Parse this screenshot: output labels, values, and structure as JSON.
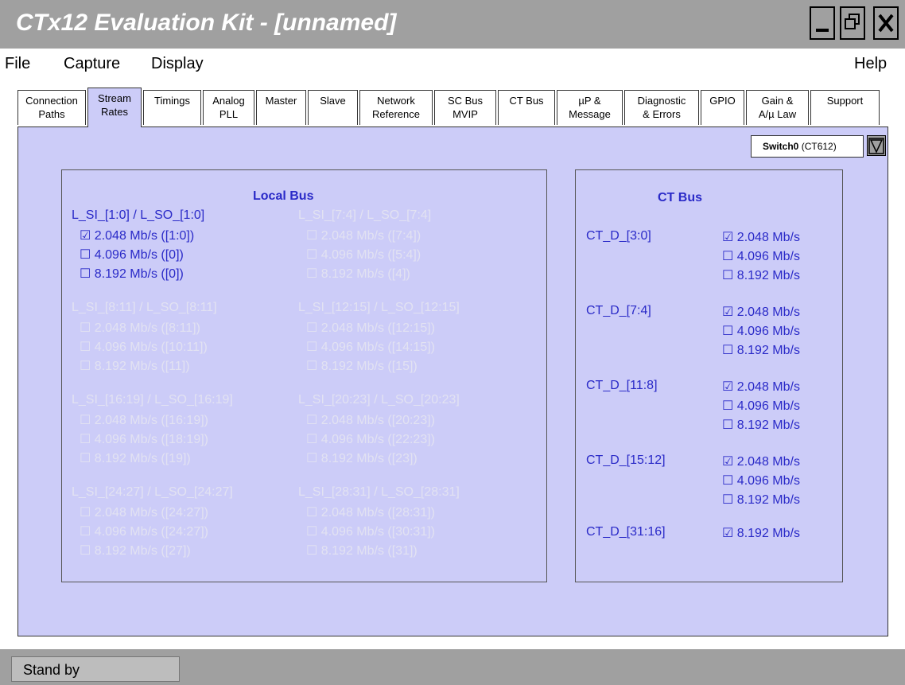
{
  "window": {
    "title": "CTx12 Evaluation Kit - [unnamed]"
  },
  "menu": {
    "file": "File",
    "capture": "Capture",
    "display": "Display",
    "help": "Help"
  },
  "tabs": [
    {
      "id": "connection",
      "line1": "Connection",
      "line2": "Paths"
    },
    {
      "id": "stream",
      "line1": "Stream",
      "line2": "Rates",
      "active": true
    },
    {
      "id": "timings",
      "line1": "Timings",
      "line2": ""
    },
    {
      "id": "analog",
      "line1": "Analog",
      "line2": "PLL"
    },
    {
      "id": "master",
      "line1": "Master",
      "line2": ""
    },
    {
      "id": "slave",
      "line1": "Slave",
      "line2": ""
    },
    {
      "id": "network",
      "line1": "Network",
      "line2": "Reference"
    },
    {
      "id": "scbus",
      "line1": "SC Bus",
      "line2": "MVIP"
    },
    {
      "id": "ctbus",
      "line1": "CT Bus",
      "line2": ""
    },
    {
      "id": "up",
      "line1": "µP &",
      "line2": "Message"
    },
    {
      "id": "diag",
      "line1": "Diagnostic",
      "line2": "& Errors"
    },
    {
      "id": "gpio",
      "line1": "GPIO",
      "line2": ""
    },
    {
      "id": "gain",
      "line1": "Gain &",
      "line2": "A/µ Law"
    },
    {
      "id": "support",
      "line1": "Support",
      "line2": ""
    }
  ],
  "device": {
    "name": "Switch0",
    "model": "(CT612)"
  },
  "local_bus": {
    "title": "Local Bus",
    "groups": [
      {
        "label": "L_SI_[1:0] / L_SO_[1:0]",
        "enabled": true,
        "options": [
          {
            "text": "2.048 Mb/s ([1:0])",
            "checked": true
          },
          {
            "text": "4.096 Mb/s ([0])",
            "checked": false
          },
          {
            "text": "8.192 Mb/s ([0])",
            "checked": false
          }
        ]
      },
      {
        "label": "L_SI_[7:4] / L_SO_[7:4]",
        "enabled": false,
        "options": [
          {
            "text": "2.048 Mb/s ([7:4])",
            "checked": false
          },
          {
            "text": "4.096 Mb/s ([5:4])",
            "checked": false
          },
          {
            "text": "8.192 Mb/s ([4])",
            "checked": false
          }
        ]
      },
      {
        "label": "L_SI_[8:11] / L_SO_[8:11]",
        "enabled": false,
        "options": [
          {
            "text": "2.048 Mb/s ([8:11])",
            "checked": false
          },
          {
            "text": "4.096 Mb/s ([10:11])",
            "checked": false
          },
          {
            "text": "8.192 Mb/s ([11])",
            "checked": false
          }
        ]
      },
      {
        "label": "L_SI_[12:15] / L_SO_[12:15]",
        "enabled": false,
        "options": [
          {
            "text": "2.048 Mb/s ([12:15])",
            "checked": false
          },
          {
            "text": "4.096 Mb/s ([14:15])",
            "checked": false
          },
          {
            "text": "8.192 Mb/s ([15])",
            "checked": false
          }
        ]
      },
      {
        "label": "L_SI_[16:19] / L_SO_[16:19]",
        "enabled": false,
        "options": [
          {
            "text": "2.048 Mb/s ([16:19])",
            "checked": false
          },
          {
            "text": "4.096 Mb/s ([18:19])",
            "checked": false
          },
          {
            "text": "8.192 Mb/s ([19])",
            "checked": false
          }
        ]
      },
      {
        "label": "L_SI_[20:23] / L_SO_[20:23]",
        "enabled": false,
        "options": [
          {
            "text": "2.048 Mb/s ([20:23])",
            "checked": false
          },
          {
            "text": "4.096 Mb/s ([22:23])",
            "checked": false
          },
          {
            "text": "8.192 Mb/s ([23])",
            "checked": false
          }
        ]
      },
      {
        "label": "L_SI_[24:27] / L_SO_[24:27]",
        "enabled": false,
        "options": [
          {
            "text": "2.048 Mb/s ([24:27])",
            "checked": false
          },
          {
            "text": "4.096 Mb/s ([24:27])",
            "checked": false
          },
          {
            "text": "8.192 Mb/s ([27])",
            "checked": false
          }
        ]
      },
      {
        "label": "L_SI_[28:31] / L_SO_[28:31]",
        "enabled": false,
        "options": [
          {
            "text": "2.048 Mb/s ([28:31])",
            "checked": false
          },
          {
            "text": "4.096 Mb/s ([30:31])",
            "checked": false
          },
          {
            "text": "8.192 Mb/s ([31])",
            "checked": false
          }
        ]
      }
    ]
  },
  "ct_bus": {
    "title": "CT Bus",
    "groups": [
      {
        "label": "CT_D_[3:0]",
        "options": [
          {
            "text": "2.048 Mb/s",
            "checked": true
          },
          {
            "text": "4.096 Mb/s",
            "checked": false
          },
          {
            "text": "8.192 Mb/s",
            "checked": false
          }
        ]
      },
      {
        "label": "CT_D_[7:4]",
        "options": [
          {
            "text": "2.048 Mb/s",
            "checked": true
          },
          {
            "text": "4.096 Mb/s",
            "checked": false
          },
          {
            "text": "8.192 Mb/s",
            "checked": false
          }
        ]
      },
      {
        "label": "CT_D_[11:8]",
        "options": [
          {
            "text": "2.048 Mb/s",
            "checked": true
          },
          {
            "text": "4.096 Mb/s",
            "checked": false
          },
          {
            "text": "8.192 Mb/s",
            "checked": false
          }
        ]
      },
      {
        "label": "CT_D_[15:12]",
        "options": [
          {
            "text": "2.048 Mb/s",
            "checked": true
          },
          {
            "text": "4.096 Mb/s",
            "checked": false
          },
          {
            "text": "8.192 Mb/s",
            "checked": false
          }
        ]
      },
      {
        "label": "CT_D_[31:16]",
        "options": [
          {
            "text": "8.192 Mb/s",
            "checked": true
          }
        ]
      }
    ]
  },
  "status": {
    "text": "Stand by"
  },
  "colors": {
    "panel": "#ccccf8",
    "text": "#2a2ac8",
    "disabled": "#e2e2f2",
    "chrome": "#a0a0a0"
  }
}
